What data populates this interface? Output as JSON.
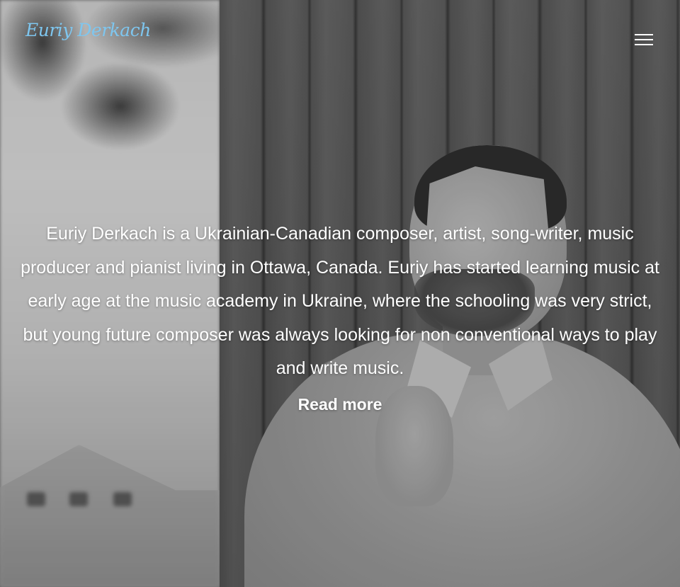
{
  "header": {
    "logo_text": "Euriy Derkach",
    "menu_icon": "hamburger-menu-icon"
  },
  "hero": {
    "bio": "Euriy Derkach is a Ukrainian-Canadian composer, artist, song-writer, music producer and pianist living in Ottawa, Canada. Euriy has started learning music at early age at the music academy in Ukraine, where the schooling was very strict, but young future composer was always looking for non conventional ways to play and write music.",
    "read_more_label": "Read more",
    "background": "black-and-white portrait photo"
  },
  "colors": {
    "logo": "#7ec6ef",
    "text": "#ffffff"
  }
}
